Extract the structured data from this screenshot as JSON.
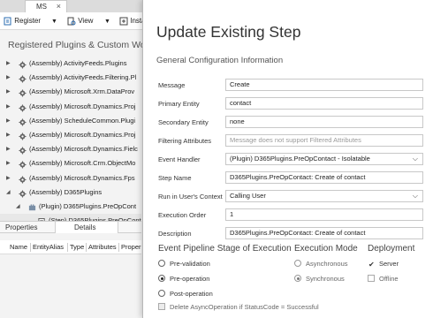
{
  "tab": {
    "label": "MS",
    "close": "×"
  },
  "toolbar": {
    "register_label": "Register",
    "view_label": "View",
    "install_label": "Insta"
  },
  "registered_title": "Registered Plugins & Custom Workf",
  "tree": [
    {
      "label": "(Assembly) ActivityFeeds.Plugins",
      "expander": "▶",
      "icon": "gear-icon"
    },
    {
      "label": "(Assembly) ActivityFeeds.Filtering.Pl",
      "expander": "▶",
      "icon": "gear-icon"
    },
    {
      "label": "(Assembly) Microsoft.Xrm.DataProv",
      "expander": "▶",
      "icon": "gear-icon"
    },
    {
      "label": "(Assembly) Microsoft.Dynamics.Proj",
      "expander": "▶",
      "icon": "gear-icon"
    },
    {
      "label": "(Assembly) ScheduleCommon.Plugi",
      "expander": "▶",
      "icon": "gear-icon"
    },
    {
      "label": "(Assembly) Microsoft.Dynamics.Proj",
      "expander": "▶",
      "icon": "gear-icon"
    },
    {
      "label": "(Assembly) Microsoft.Dynamics.Fielc",
      "expander": "▶",
      "icon": "gear-icon"
    },
    {
      "label": "(Assembly) Microsoft.Crm.ObjectMo",
      "expander": "▶",
      "icon": "gear-icon"
    },
    {
      "label": "(Assembly) Microsoft.Dynamics.Fps",
      "expander": "▶",
      "icon": "gear-icon"
    },
    {
      "label": "(Assembly) D365Plugins",
      "expander": "◢",
      "icon": "gear-icon"
    },
    {
      "label": "(Plugin) D365Plugins.PreOpCont",
      "expander": "◢",
      "icon": "plugin-icon"
    },
    {
      "label": "(Step) D365Plugins.PreOpCont",
      "expander": "",
      "icon": "step-icon"
    }
  ],
  "lower_tabs": {
    "properties": "Properties",
    "details": "Details"
  },
  "columns": [
    "Name",
    "EntityAlias",
    "Type",
    "Attributes",
    "Proper"
  ],
  "dialog": {
    "title": "Update Existing Step",
    "subtitle": "General Configuration Information",
    "fields": {
      "message": {
        "label": "Message",
        "value": "Create"
      },
      "primary_entity": {
        "label": "Primary Entity",
        "value": "contact"
      },
      "secondary_entity": {
        "label": "Secondary Entity",
        "value": "none"
      },
      "filtering_attributes": {
        "label": "Filtering Attributes",
        "placeholder": "Message does not support Filtered Attributes"
      },
      "event_handler": {
        "label": "Event Handler",
        "value": "(Plugin) D365Plugins.PreOpContact - Isolatable"
      },
      "step_name": {
        "label": "Step Name",
        "value": "D365Plugins.PreOpContact: Create of contact"
      },
      "run_in_context": {
        "label": "Run in User's Context",
        "value": "Calling User"
      },
      "execution_order": {
        "label": "Execution Order",
        "value": "1"
      },
      "description": {
        "label": "Description",
        "value": "D365Plugins.PreOpContact: Create of contact"
      }
    },
    "stage": {
      "heading": "Event Pipeline Stage of Execution",
      "options": [
        "Pre-validation",
        "Pre-operation",
        "Post-operation"
      ],
      "selected": "Pre-operation",
      "delete_async_label": "Delete AsyncOperation if StatusCode = Successful"
    },
    "mode": {
      "heading": "Execution Mode",
      "options": [
        "Asynchronous",
        "Synchronous"
      ],
      "selected": "Synchronous"
    },
    "deployment": {
      "heading": "Deployment",
      "server_label": "Server",
      "server_checked": true,
      "offline_label": "Offline",
      "offline_checked": false
    }
  }
}
